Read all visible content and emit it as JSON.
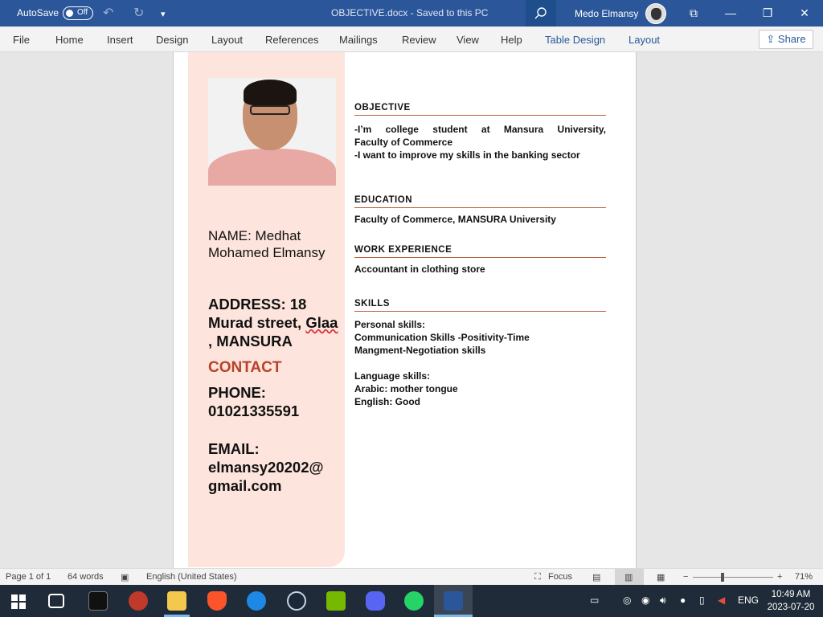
{
  "titlebar": {
    "autosave_label": "AutoSave",
    "autosave_state": "Off",
    "document_title": "OBJECTIVE.docx  -  Saved to this PC",
    "user_name": "Medo Elmansy"
  },
  "menu": {
    "tabs": [
      "File",
      "Home",
      "Insert",
      "Design",
      "Layout",
      "References",
      "Mailings",
      "Review",
      "View",
      "Help"
    ],
    "context_tabs": [
      "Table Design",
      "Layout"
    ],
    "share_label": "Share"
  },
  "resume": {
    "name": "NAME: Medhat Mohamed Elmansy",
    "address_prefix": "ADDRESS: 18 Murad street, ",
    "address_misspelled": "Glaa ,",
    "address_suffix": " MANSURA",
    "contact_heading": "CONTACT",
    "phone": "PHONE: 01021335591",
    "email": "EMAIL: elmansy20202@ gmail.com",
    "objective": {
      "heading": "OBJECTIVE",
      "line1": "-I’m college student at Mansura University,",
      "line2": "Faculty of Commerce",
      "line3": "-I want to improve my skills in the banking sector"
    },
    "education": {
      "heading": "EDUCATION",
      "text": "Faculty of Commerce, MANSURA University"
    },
    "work": {
      "heading": "WORK EXPERIENCE",
      "text": "Accountant in clothing store"
    },
    "skills": {
      "heading": "SKILLS",
      "personal_title": "Personal skills:",
      "personal_line1": "Communication Skills -Positivity-Time",
      "personal_line2": "Mangment-Negotiation skills",
      "language_title": "Language skills:",
      "arabic": "Arabic: mother tongue",
      "english": "English: Good"
    }
  },
  "statusbar": {
    "page": "Page 1 of 1",
    "words": "64 words",
    "language": "English (United States)",
    "focus": "Focus",
    "zoom": "71%",
    "zoom_fraction": 0.35
  },
  "taskbar": {
    "lang": "ENG",
    "time": "10:49 AM",
    "date": "2023-07-20"
  },
  "colors": {
    "title_bar": "#2b579a",
    "sidebar_fill": "#fde4dd",
    "accent": "#b5432a"
  }
}
